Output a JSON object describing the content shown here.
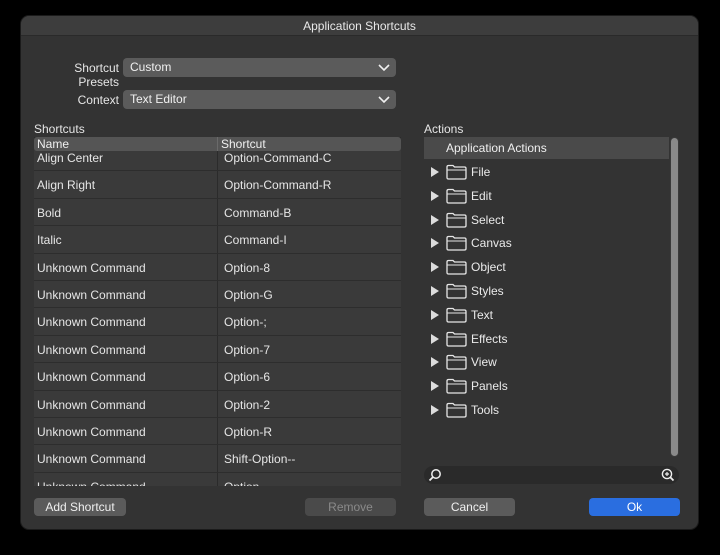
{
  "window": {
    "title": "Application Shortcuts"
  },
  "presets": {
    "label": "Shortcut Presets",
    "value": "Custom"
  },
  "context": {
    "label": "Context",
    "value": "Text Editor"
  },
  "shortcuts": {
    "label": "Shortcuts",
    "columns": [
      "Name",
      "Shortcut"
    ],
    "rows": [
      {
        "name": "Align Center",
        "key": "Option-Command-C"
      },
      {
        "name": "Align Right",
        "key": "Option-Command-R"
      },
      {
        "name": "Bold",
        "key": "Command-B"
      },
      {
        "name": "Italic",
        "key": "Command-I"
      },
      {
        "name": "Unknown Command",
        "key": "Option-8"
      },
      {
        "name": "Unknown Command",
        "key": "Option-G"
      },
      {
        "name": "Unknown Command",
        "key": "Option-;"
      },
      {
        "name": "Unknown Command",
        "key": "Option-7"
      },
      {
        "name": "Unknown Command",
        "key": "Option-6"
      },
      {
        "name": "Unknown Command",
        "key": "Option-2"
      },
      {
        "name": "Unknown Command",
        "key": "Option-R"
      },
      {
        "name": "Unknown Command",
        "key": "Shift-Option--"
      },
      {
        "name": "Unknown Command",
        "key": "Option--"
      }
    ]
  },
  "actions": {
    "label": "Actions",
    "header": "Application Actions",
    "items": [
      "File",
      "Edit",
      "Select",
      "Canvas",
      "Object",
      "Styles",
      "Text",
      "Effects",
      "View",
      "Panels",
      "Tools"
    ]
  },
  "search": {
    "value": ""
  },
  "buttons": {
    "add": "Add Shortcut",
    "remove": "Remove",
    "cancel": "Cancel",
    "ok": "Ok"
  },
  "colors": {
    "accent": "#2a6ee0",
    "background": "#333333"
  }
}
